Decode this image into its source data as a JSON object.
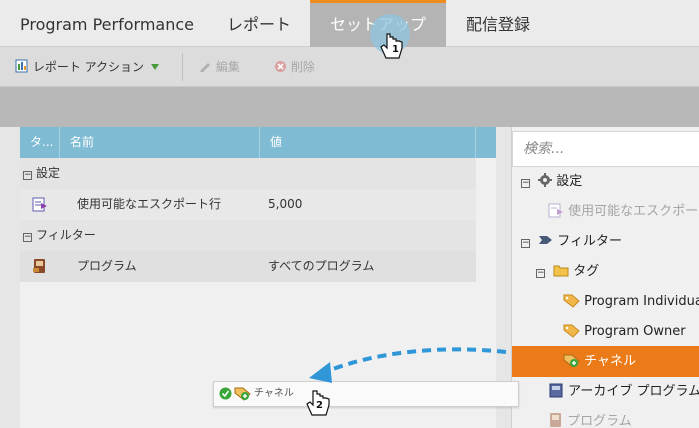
{
  "tabs": {
    "program_performance": "Program Performance",
    "report": "レポート",
    "setup": "セットアップ",
    "subscriptions": "配信登録"
  },
  "toolbar": {
    "report_actions": "レポート アクション",
    "edit": "編集",
    "delete": "削除"
  },
  "table": {
    "columns": [
      "タ...",
      "名前",
      "値"
    ],
    "groups": [
      {
        "label": "設定",
        "rows": [
          {
            "name": "使用可能なエスクポート行",
            "value": "5,000"
          }
        ]
      },
      {
        "label": "フィルター",
        "rows": [
          {
            "name": "プログラム",
            "value": "すべてのプログラム"
          }
        ]
      }
    ]
  },
  "tree": {
    "search_placeholder": "検索...",
    "settings": "設定",
    "export_rows": "使用可能なエスクポート行",
    "filters": "フィルター",
    "tags": "タグ",
    "program_individual": "Program Individual",
    "program_owner": "Program Owner",
    "channel": "チャネル",
    "archive": "アーカイブ プログラム",
    "program": "プログラム"
  },
  "drag": {
    "label": "チャネル"
  },
  "steps": {
    "one": "1",
    "two": "2"
  },
  "colors": {
    "accent": "#ea7b18",
    "header_blue": "#7fbcd4",
    "drag_arrow": "#2f96d8",
    "tab_active": "#b4b4b4"
  }
}
